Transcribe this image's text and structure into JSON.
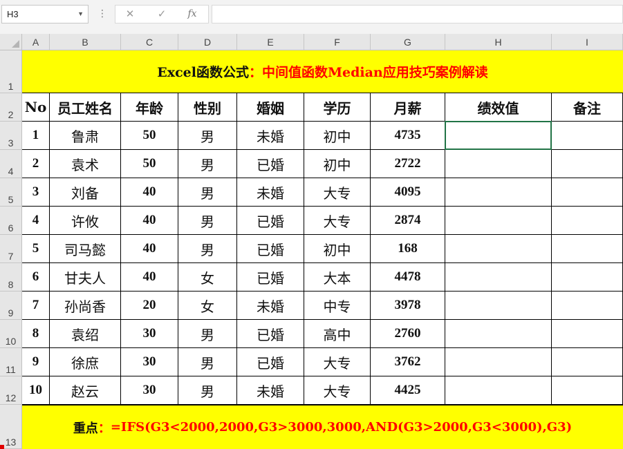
{
  "formula_bar": {
    "name_box": "H3",
    "name_box_dropdown_icon": "chevron-down-icon",
    "cancel_icon": "✕",
    "enter_icon": "✓",
    "fx_label": "fx",
    "formula": ""
  },
  "sheet": {
    "columns": [
      "A",
      "B",
      "C",
      "D",
      "E",
      "F",
      "G",
      "H",
      "I"
    ],
    "rows": [
      "1",
      "2",
      "3",
      "4",
      "5",
      "6",
      "7",
      "8",
      "9",
      "10",
      "11",
      "12",
      "13"
    ],
    "title_prefix": "Excel函数公式",
    "title_colon": "：",
    "title_main": "中间值函数Median应用技巧案例解读",
    "headers": [
      "No",
      "员工姓名",
      "年龄",
      "性别",
      "婚姻",
      "学历",
      "月薪",
      "绩效值",
      "备注"
    ],
    "data": [
      [
        "1",
        "鲁肃",
        "50",
        "男",
        "未婚",
        "初中",
        "4735",
        "",
        ""
      ],
      [
        "2",
        "袁术",
        "50",
        "男",
        "已婚",
        "初中",
        "2722",
        "",
        ""
      ],
      [
        "3",
        "刘备",
        "40",
        "男",
        "未婚",
        "大专",
        "4095",
        "",
        ""
      ],
      [
        "4",
        "许攸",
        "40",
        "男",
        "已婚",
        "大专",
        "2874",
        "",
        ""
      ],
      [
        "5",
        "司马懿",
        "40",
        "男",
        "已婚",
        "初中",
        "168",
        "",
        ""
      ],
      [
        "6",
        "甘夫人",
        "40",
        "女",
        "已婚",
        "大本",
        "4478",
        "",
        ""
      ],
      [
        "7",
        "孙尚香",
        "20",
        "女",
        "未婚",
        "中专",
        "3978",
        "",
        ""
      ],
      [
        "8",
        "袁绍",
        "30",
        "男",
        "已婚",
        "高中",
        "2760",
        "",
        ""
      ],
      [
        "9",
        "徐庶",
        "30",
        "男",
        "已婚",
        "大专",
        "3762",
        "",
        ""
      ],
      [
        "10",
        "赵云",
        "30",
        "男",
        "未婚",
        "大专",
        "4425",
        "",
        ""
      ]
    ],
    "note_label": "重点：",
    "note_formula": "=IFS(G3<2000,2000,G3>3000,3000,AND(G3>2000,G3<3000),G3)",
    "selected_cell": "H3",
    "colors": {
      "title_fill": "#ffff00",
      "accent_red": "#ff0000",
      "selection": "#217346"
    }
  }
}
